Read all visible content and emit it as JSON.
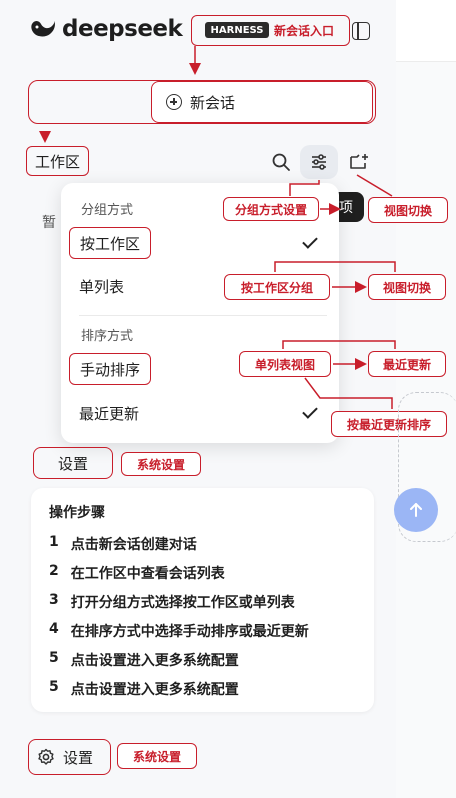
{
  "header": {
    "logo_text": "deepseek",
    "badge": "HARNESS",
    "new_chat_entry_label": "新会话入口",
    "panel_icon": "sidebar-toggle-icon"
  },
  "new_chat": {
    "label": "新会话"
  },
  "workspace": {
    "label": "工作区",
    "hidden_text": "暂",
    "dark_button_text": "项"
  },
  "dropdown": {
    "group_section": "分组方式",
    "group_items": [
      {
        "label": "按工作区",
        "checked": true
      },
      {
        "label": "单列表",
        "checked": false
      }
    ],
    "sort_section": "排序方式",
    "sort_items": [
      {
        "label": "手动排序",
        "checked": false
      },
      {
        "label": "最近更新",
        "checked": true
      }
    ]
  },
  "annotations": {
    "group_settings": "分组方式设置",
    "view_switch": "视图切换",
    "group_by_workspace": "按工作区分组",
    "view_switch_2": "视图切换",
    "single_list_view": "单列表视图",
    "recent_update": "最近更新",
    "sort_by_recent": "按最近更新排序",
    "system_settings": "系统设置",
    "system_settings_bottom": "系统设置"
  },
  "settings": {
    "label": "设置"
  },
  "steps": {
    "title": "操作步骤",
    "items": [
      {
        "num": "1",
        "text": "点击新会话创建对话"
      },
      {
        "num": "2",
        "text": "在工作区中查看会话列表"
      },
      {
        "num": "3",
        "text": "打开分组方式选择按工作区或单列表"
      },
      {
        "num": "4",
        "text": "在排序方式中选择手动排序或最近更新"
      },
      {
        "num": "5",
        "text": "点击设置进入更多系统配置"
      },
      {
        "num": "5",
        "text": "点击设置进入更多系统配置"
      }
    ]
  },
  "bottom": {
    "settings_label": "设置"
  },
  "colors": {
    "annotation_red": "#c81e2b",
    "scroll_button": "#9bb6f5"
  }
}
